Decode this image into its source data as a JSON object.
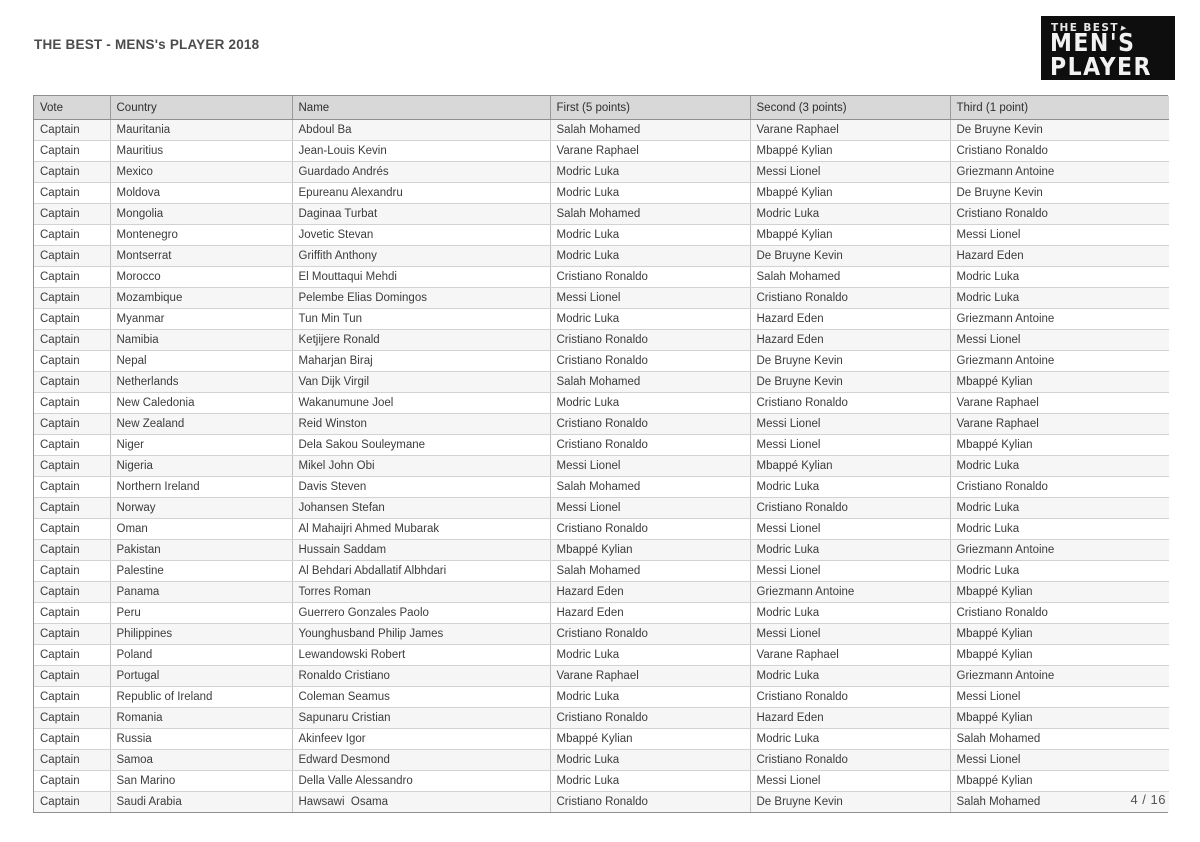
{
  "document": {
    "title": "THE BEST - MENS's PLAYER 2018",
    "page_number": "4 / 16"
  },
  "logo": {
    "line1": "THE BEST",
    "line2": "MEN'S",
    "line3": "PLAYER"
  },
  "table": {
    "columns": [
      "Vote",
      "Country",
      "Name",
      "First (5 points)",
      "Second (3 points)",
      "Third (1 point)"
    ],
    "rows": [
      [
        "Captain",
        "Mauritania",
        "Abdoul Ba",
        "Salah Mohamed",
        "Varane Raphael",
        "De Bruyne Kevin"
      ],
      [
        "Captain",
        "Mauritius",
        "Jean-Louis Kevin",
        "Varane Raphael",
        "Mbappé Kylian",
        "Cristiano Ronaldo"
      ],
      [
        "Captain",
        "Mexico",
        "Guardado Andrés",
        "Modric Luka",
        "Messi Lionel",
        "Griezmann Antoine"
      ],
      [
        "Captain",
        "Moldova",
        "Epureanu Alexandru",
        "Modric Luka",
        "Mbappé Kylian",
        "De Bruyne Kevin"
      ],
      [
        "Captain",
        "Mongolia",
        "Daginaa Turbat",
        "Salah Mohamed",
        "Modric Luka",
        "Cristiano Ronaldo"
      ],
      [
        "Captain",
        "Montenegro",
        "Jovetic Stevan",
        "Modric Luka",
        "Mbappé Kylian",
        "Messi Lionel"
      ],
      [
        "Captain",
        "Montserrat",
        "Griffith Anthony",
        "Modric Luka",
        "De Bruyne Kevin",
        "Hazard Eden"
      ],
      [
        "Captain",
        "Morocco",
        "El Mouttaqui Mehdi",
        "Cristiano Ronaldo",
        "Salah Mohamed",
        "Modric Luka"
      ],
      [
        "Captain",
        "Mozambique",
        "Pelembe Elias Domingos",
        "Messi Lionel",
        "Cristiano Ronaldo",
        "Modric Luka"
      ],
      [
        "Captain",
        "Myanmar",
        "Tun Min Tun",
        "Modric Luka",
        "Hazard Eden",
        "Griezmann Antoine"
      ],
      [
        "Captain",
        "Namibia",
        "Ketjijere Ronald",
        "Cristiano Ronaldo",
        "Hazard Eden",
        "Messi Lionel"
      ],
      [
        "Captain",
        "Nepal",
        "Maharjan Biraj",
        "Cristiano Ronaldo",
        "De Bruyne Kevin",
        "Griezmann Antoine"
      ],
      [
        "Captain",
        "Netherlands",
        "Van Dijk Virgil",
        "Salah Mohamed",
        "De Bruyne Kevin",
        "Mbappé Kylian"
      ],
      [
        "Captain",
        "New Caledonia",
        "Wakanumune Joel",
        "Modric Luka",
        "Cristiano Ronaldo",
        "Varane Raphael"
      ],
      [
        "Captain",
        "New Zealand",
        "Reid Winston",
        "Cristiano Ronaldo",
        "Messi Lionel",
        "Varane Raphael"
      ],
      [
        "Captain",
        "Niger",
        "Dela Sakou Souleymane",
        "Cristiano Ronaldo",
        "Messi Lionel",
        "Mbappé Kylian"
      ],
      [
        "Captain",
        "Nigeria",
        "Mikel John Obi",
        "Messi Lionel",
        "Mbappé Kylian",
        "Modric Luka"
      ],
      [
        "Captain",
        "Northern Ireland",
        "Davis Steven",
        "Salah Mohamed",
        "Modric Luka",
        "Cristiano Ronaldo"
      ],
      [
        "Captain",
        "Norway",
        "Johansen Stefan",
        "Messi Lionel",
        "Cristiano Ronaldo",
        "Modric Luka"
      ],
      [
        "Captain",
        "Oman",
        "Al Mahaijri Ahmed Mubarak",
        "Cristiano Ronaldo",
        "Messi Lionel",
        "Modric Luka"
      ],
      [
        "Captain",
        "Pakistan",
        "Hussain Saddam",
        "Mbappé Kylian",
        "Modric Luka",
        "Griezmann Antoine"
      ],
      [
        "Captain",
        "Palestine",
        "Al Behdari Abdallatif Albhdari",
        "Salah Mohamed",
        "Messi Lionel",
        "Modric Luka"
      ],
      [
        "Captain",
        "Panama",
        "Torres Roman",
        "Hazard Eden",
        "Griezmann Antoine",
        "Mbappé Kylian"
      ],
      [
        "Captain",
        "Peru",
        "Guerrero Gonzales Paolo",
        "Hazard Eden",
        "Modric Luka",
        "Cristiano Ronaldo"
      ],
      [
        "Captain",
        "Philippines",
        "Younghusband Philip James",
        "Cristiano Ronaldo",
        "Messi Lionel",
        "Mbappé Kylian"
      ],
      [
        "Captain",
        "Poland",
        "Lewandowski Robert",
        "Modric Luka",
        "Varane Raphael",
        "Mbappé Kylian"
      ],
      [
        "Captain",
        "Portugal",
        "Ronaldo Cristiano",
        "Varane Raphael",
        "Modric Luka",
        "Griezmann Antoine"
      ],
      [
        "Captain",
        "Republic of Ireland",
        "Coleman Seamus",
        "Modric Luka",
        "Cristiano Ronaldo",
        "Messi Lionel"
      ],
      [
        "Captain",
        "Romania",
        "Sapunaru Cristian",
        "Cristiano Ronaldo",
        "Hazard Eden",
        "Mbappé Kylian"
      ],
      [
        "Captain",
        "Russia",
        "Akinfeev Igor",
        "Mbappé Kylian",
        "Modric Luka",
        "Salah Mohamed"
      ],
      [
        "Captain",
        "Samoa",
        "Edward Desmond",
        "Modric Luka",
        "Cristiano Ronaldo",
        "Messi Lionel"
      ],
      [
        "Captain",
        "San Marino",
        "Della Valle Alessandro",
        "Modric Luka",
        "Messi Lionel",
        "Mbappé Kylian"
      ],
      [
        "Captain",
        "Saudi Arabia",
        "Hawsawi  Osama",
        "Cristiano Ronaldo",
        "De Bruyne Kevin",
        "Salah Mohamed"
      ]
    ]
  }
}
